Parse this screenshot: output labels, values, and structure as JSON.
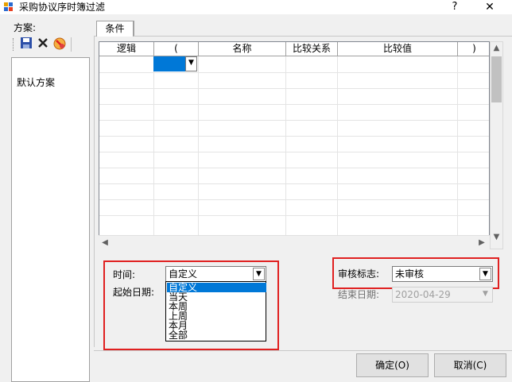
{
  "window": {
    "title": "采购协议序时簿过滤",
    "help": "?",
    "close": "✕"
  },
  "left_panel": {
    "scheme_label": "方案:",
    "toolbar": [
      {
        "icon": "save-icon"
      },
      {
        "icon": "delete-icon"
      },
      {
        "icon": "cancel-icon"
      }
    ],
    "schemes": [
      "默认方案"
    ]
  },
  "tabs": [
    {
      "label": "条件",
      "active": true
    }
  ],
  "grid": {
    "columns": [
      "逻辑",
      "(",
      "名称",
      "比较关系",
      "比较值",
      ")"
    ],
    "scroll_up": "▲",
    "scroll_down": "▼",
    "scroll_left": "◀",
    "scroll_right": "▶",
    "dropdown_arrow": "▼"
  },
  "filters": {
    "time_label": "时间:",
    "time_value": "自定义",
    "time_options": [
      "自定义",
      "当天",
      "本周",
      "上周",
      "本月",
      "全部"
    ],
    "time_selected_index": 0,
    "start_date_label": "起始日期:",
    "audit_label": "审核标志:",
    "audit_value": "未审核",
    "end_date_label": "结束日期:",
    "end_date_value": "2020-04-29",
    "arrow": "▼"
  },
  "buttons": {
    "ok": "确定(O)",
    "cancel": "取消(C)"
  },
  "colors": {
    "selection": "#0078d7",
    "highlight_box": "#e02020"
  }
}
